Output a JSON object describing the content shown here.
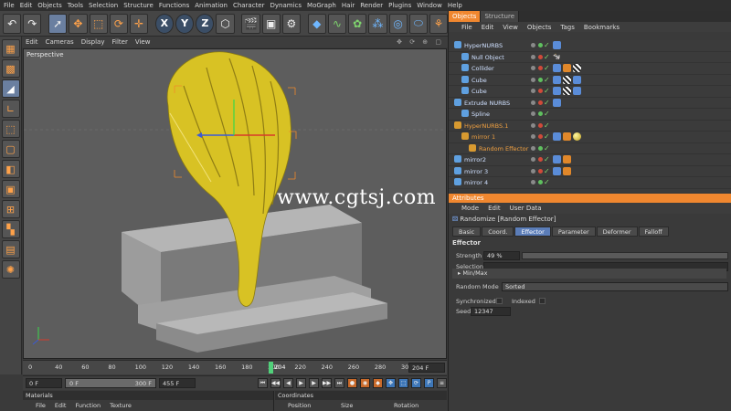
{
  "menu": [
    "File",
    "Edit",
    "Objects",
    "Tools",
    "Selection",
    "Structure",
    "Functions",
    "Animation",
    "Character",
    "Dynamics",
    "MoGraph",
    "Hair",
    "Render",
    "Plugins",
    "Window",
    "Help"
  ],
  "viewport": {
    "menu": [
      "Edit",
      "Cameras",
      "Display",
      "Filter",
      "View"
    ],
    "label": "Perspective",
    "watermark": "www.cgtsj.com"
  },
  "timeline": {
    "ticks": [
      "0",
      "40",
      "60",
      "80",
      "100",
      "120",
      "140",
      "160",
      "180",
      "200",
      "220",
      "240",
      "260",
      "280",
      "300"
    ],
    "current_frame": "204",
    "end_frame": "204 F",
    "playhead_fraction": 0.645
  },
  "transport": {
    "start": "0 F",
    "range_start": "0 F",
    "range_end": "300 F",
    "end": "455 F"
  },
  "materials": {
    "title": "Materials",
    "menu": [
      "File",
      "Edit",
      "Function",
      "Texture"
    ]
  },
  "coordinates": {
    "title": "Coordinates",
    "cols": [
      "Position",
      "Size",
      "Rotation"
    ]
  },
  "objects": {
    "tabs": [
      "Objects",
      "Structure"
    ],
    "menu": [
      "File",
      "Edit",
      "View",
      "Objects",
      "Tags",
      "Bookmarks"
    ],
    "items": [
      {
        "name": "HyperNURBS",
        "indent": 0,
        "highlight": false,
        "tags": [
          "blue"
        ]
      },
      {
        "name": "Null Object",
        "indent": 1,
        "highlight": false,
        "tags": [
          "cow"
        ]
      },
      {
        "name": "Collider",
        "indent": 1,
        "highlight": false,
        "tags": [
          "blue",
          "orange",
          "chk"
        ]
      },
      {
        "name": "Cube",
        "indent": 1,
        "highlight": false,
        "tags": [
          "blue",
          "chk",
          "blue"
        ]
      },
      {
        "name": "Cube",
        "indent": 1,
        "highlight": false,
        "tags": [
          "blue",
          "chk",
          "blue"
        ]
      },
      {
        "name": "Extrude NURBS",
        "indent": 0,
        "highlight": false,
        "tags": [
          "blue"
        ]
      },
      {
        "name": "Spline",
        "indent": 1,
        "highlight": false,
        "tags": []
      },
      {
        "name": "HyperNURBS.1",
        "indent": 0,
        "highlight": true,
        "tags": []
      },
      {
        "name": "mirror 1",
        "indent": 1,
        "highlight": true,
        "tags": [
          "blue",
          "orange",
          "yellow"
        ]
      },
      {
        "name": "Random Effector",
        "indent": 2,
        "highlight": true,
        "tags": []
      },
      {
        "name": "mirror2",
        "indent": 0,
        "highlight": false,
        "tags": [
          "blue",
          "orange"
        ]
      },
      {
        "name": "mirror 3",
        "indent": 0,
        "highlight": false,
        "tags": [
          "blue",
          "orange"
        ]
      },
      {
        "name": "mirror 4",
        "indent": 0,
        "highlight": false,
        "tags": []
      }
    ]
  },
  "attributes": {
    "title": "Attributes",
    "menu": [
      "Mode",
      "Edit",
      "User Data"
    ],
    "object_label": "Randomize [Random Effector]",
    "tabs": [
      "Basic",
      "Coord.",
      "Effector",
      "Parameter",
      "Deformer",
      "Falloff"
    ],
    "active_tab": "Effector",
    "section": "Effector",
    "strength_label": "Strength",
    "strength_value": "49 %",
    "selection_label": "Selection",
    "minmax_label": "Min/Max",
    "random_mode_label": "Random Mode",
    "random_mode_value": "Sorted",
    "synchronized_label": "Synchronized",
    "indexed_label": "Indexed",
    "seed_label": "Seed",
    "seed_value": "12347"
  }
}
